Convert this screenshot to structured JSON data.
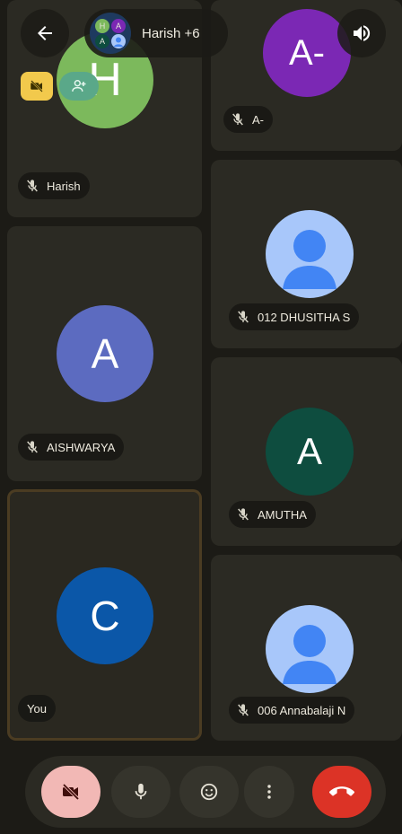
{
  "header": {
    "group_label": "Harish +6",
    "mini_avatars": [
      "H",
      "A",
      "A",
      "S"
    ]
  },
  "badges": {
    "camera_off_icon": "video-off-icon",
    "add_person_icon": "person-add-icon"
  },
  "participants": [
    {
      "name": "Harish",
      "initial": "H",
      "color": "#7cb95c",
      "muted": true
    },
    {
      "name": "A-",
      "initial": "A-",
      "color": "#7b28b4",
      "muted": true
    },
    {
      "name": "012 DHUSITHA S",
      "initial": "",
      "color": "#a8c7fa",
      "muted": true
    },
    {
      "name": "AISHWARYA",
      "initial": "A",
      "color": "#5c6bc0",
      "muted": true
    },
    {
      "name": "AMUTHA",
      "initial": "A",
      "color": "#0e4d3f",
      "muted": true
    },
    {
      "name": "You",
      "initial": "C",
      "color": "#0b57a8",
      "muted": false
    },
    {
      "name": "006 Annabalaji N",
      "initial": "",
      "color": "#a8c7fa",
      "muted": true
    }
  ],
  "controls": [
    {
      "name": "camera-toggle",
      "icon": "video-off-icon",
      "color": "#f2b8b5"
    },
    {
      "name": "mic-toggle",
      "icon": "mic-icon",
      "color": "#35342c"
    },
    {
      "name": "reactions",
      "icon": "smile-icon",
      "color": "#35342c"
    },
    {
      "name": "more-options",
      "icon": "more-vert-icon",
      "color": "#35342c"
    },
    {
      "name": "end-call",
      "icon": "call-end-icon",
      "color": "#dc3326"
    }
  ]
}
